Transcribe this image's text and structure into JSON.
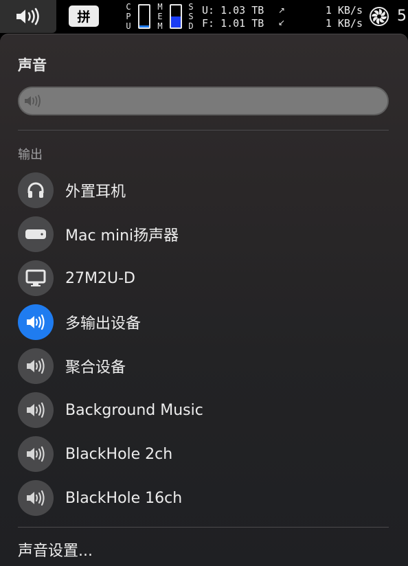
{
  "menubar": {
    "ime_label": "拼",
    "cpu_label": "CPU",
    "mem_label": "MEM",
    "ssd_label": "SSD",
    "cpu_usage_fraction": 0.08,
    "mem_usage_fraction": 0.5,
    "disk_used": "U:  1.03 TB",
    "disk_free": "F:  1.01 TB",
    "net_up": "1 KB/s",
    "net_down": "1 KB/s",
    "fan_value": "5"
  },
  "sound_panel": {
    "title": "声音",
    "volume_fraction": 0.0,
    "output_label": "输出",
    "devices": [
      {
        "label": "外置耳机",
        "icon": "headphones-icon",
        "active": false
      },
      {
        "label": "Mac mini扬声器",
        "icon": "mac-mini-icon",
        "active": false
      },
      {
        "label": "27M2U-D",
        "icon": "display-icon",
        "active": false
      },
      {
        "label": "多输出设备",
        "icon": "speaker-icon",
        "active": true
      },
      {
        "label": "聚合设备",
        "icon": "speaker-icon",
        "active": false
      },
      {
        "label": "Background Music",
        "icon": "speaker-icon",
        "active": false
      },
      {
        "label": "BlackHole 2ch",
        "icon": "speaker-icon",
        "active": false
      },
      {
        "label": "BlackHole 16ch",
        "icon": "speaker-icon",
        "active": false
      }
    ],
    "settings_label": "声音设置..."
  },
  "colors": {
    "accent": "#1f7cf0",
    "mem_gauge": "#1a3cf5",
    "cpu_gauge": "#1f7cf0"
  }
}
